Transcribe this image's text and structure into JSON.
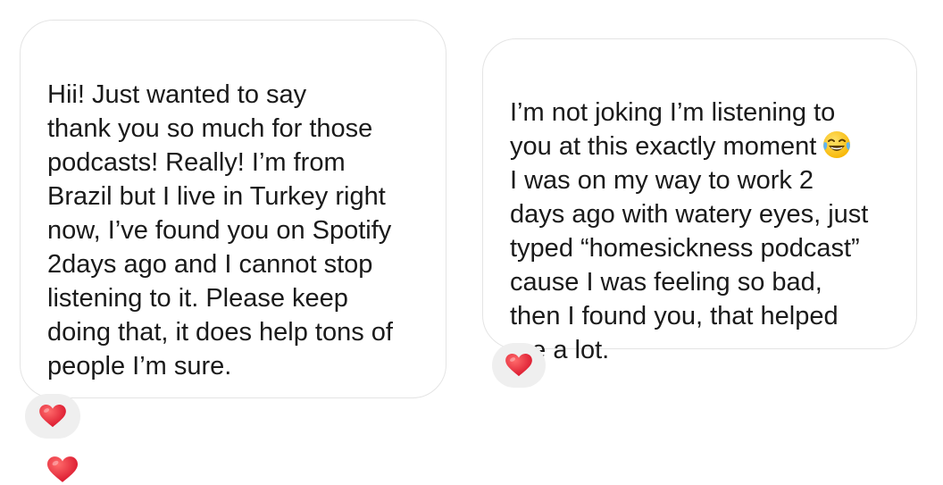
{
  "messages": [
    {
      "text": "Hii! Just wanted to say\nthank you so much for those\npodcasts! Really! I’m from\nBrazil but I live in Turkey right\nnow, I’ve found you on Spotify\n2days ago and I cannot stop\nlistening to it. Please keep\ndoing that, it does help tons of\npeople I’m sure.",
      "trailing_emoji": "heart-emoji",
      "reaction": "heart-emoji"
    },
    {
      "text_before_emoji": "I’m not joking I’m listening to\nyou at this exactly moment",
      "inline_emoji": "tears-of-joy-emoji",
      "text_after_emoji": "I was on my way to work 2\ndays ago with watery eyes, just\ntyped “homesickness podcast”\ncause I was feeling so bad,\nthen I found you, that helped\nme a lot.",
      "reaction": "heart-emoji"
    }
  ],
  "colors": {
    "bubble_background": "#ffffff",
    "bubble_border": "#e4e4e4",
    "reaction_background": "#efefef",
    "heart": "#e8283a",
    "text": "#1a1a1a"
  }
}
